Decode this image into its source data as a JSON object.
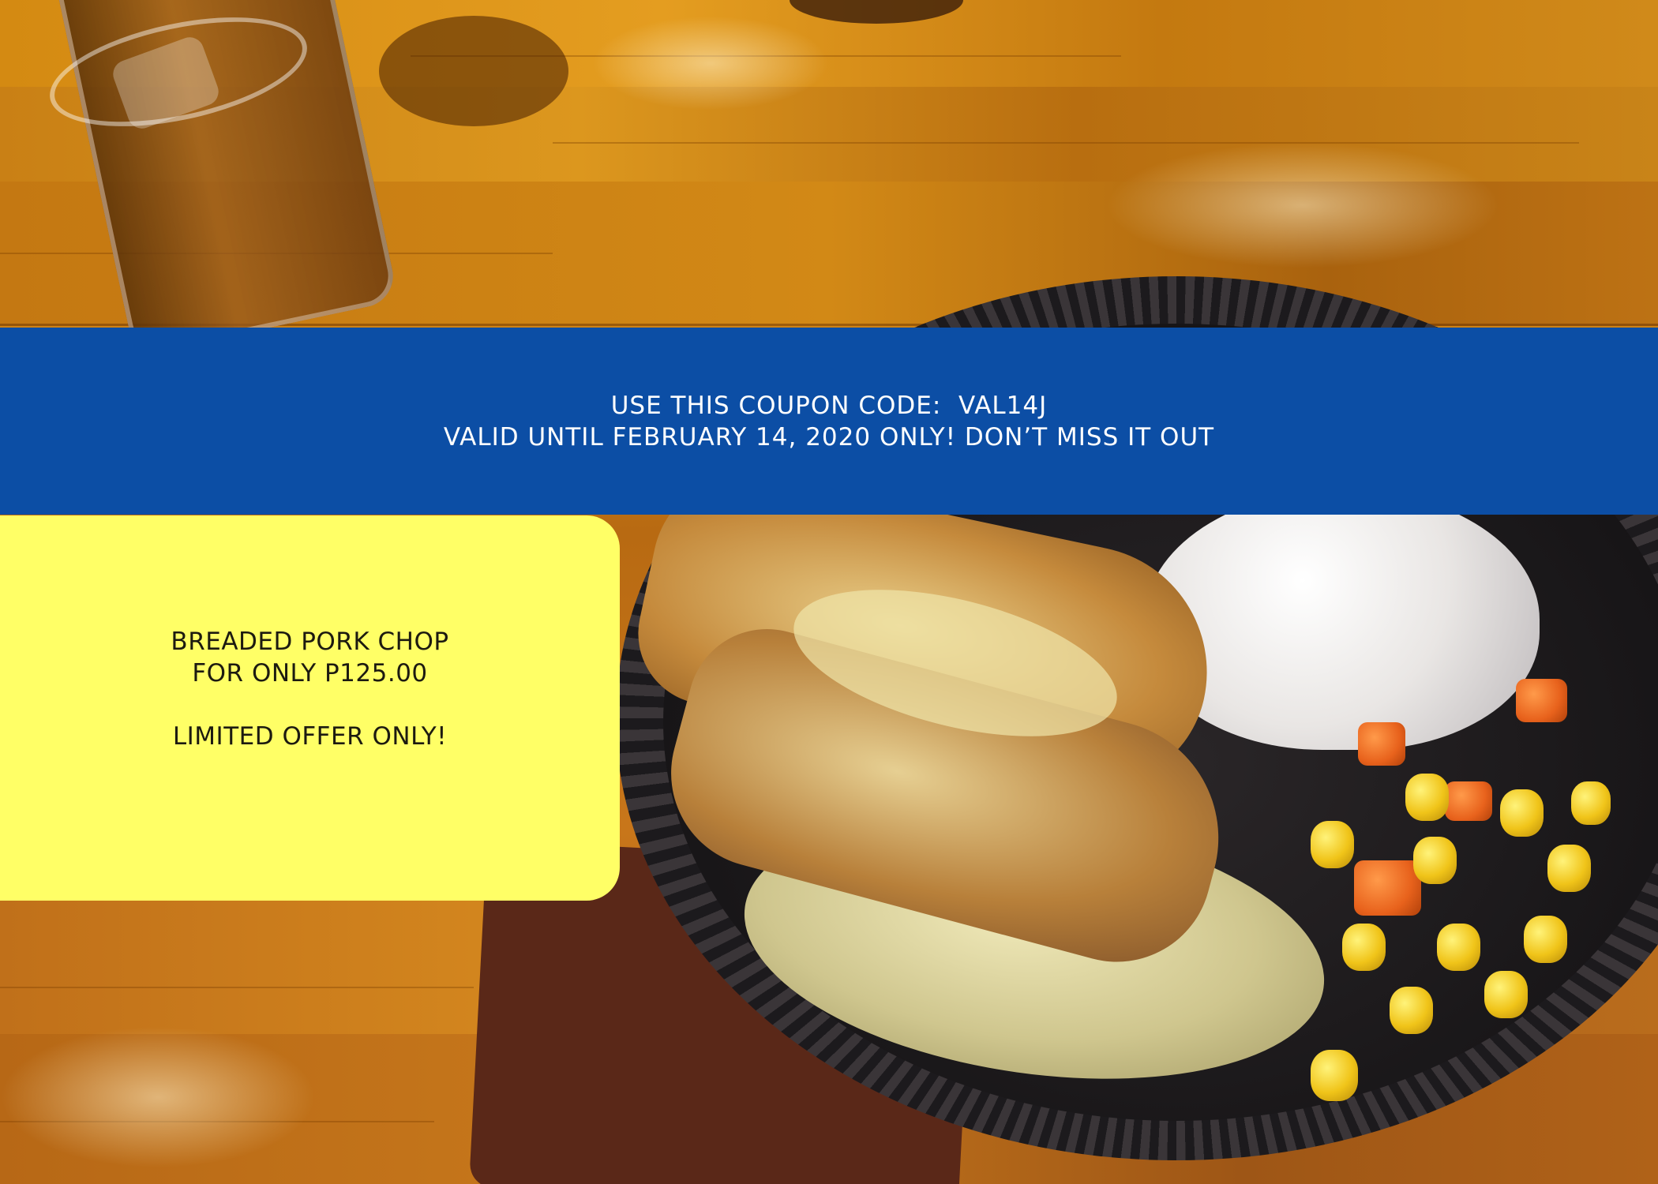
{
  "coupon": {
    "line1": "USE THIS COUPON CODE:  VAL14J",
    "line2": "VALID UNTIL FEBRUARY 14, 2020 ONLY! DON’T MISS IT OUT"
  },
  "offer": {
    "line1": "BREADED PORK CHOP",
    "line2": "FOR ONLY P125.00",
    "line3": "LIMITED OFFER ONLY!"
  },
  "colors": {
    "band": "#0c4ea5",
    "card": "#ffff66"
  }
}
